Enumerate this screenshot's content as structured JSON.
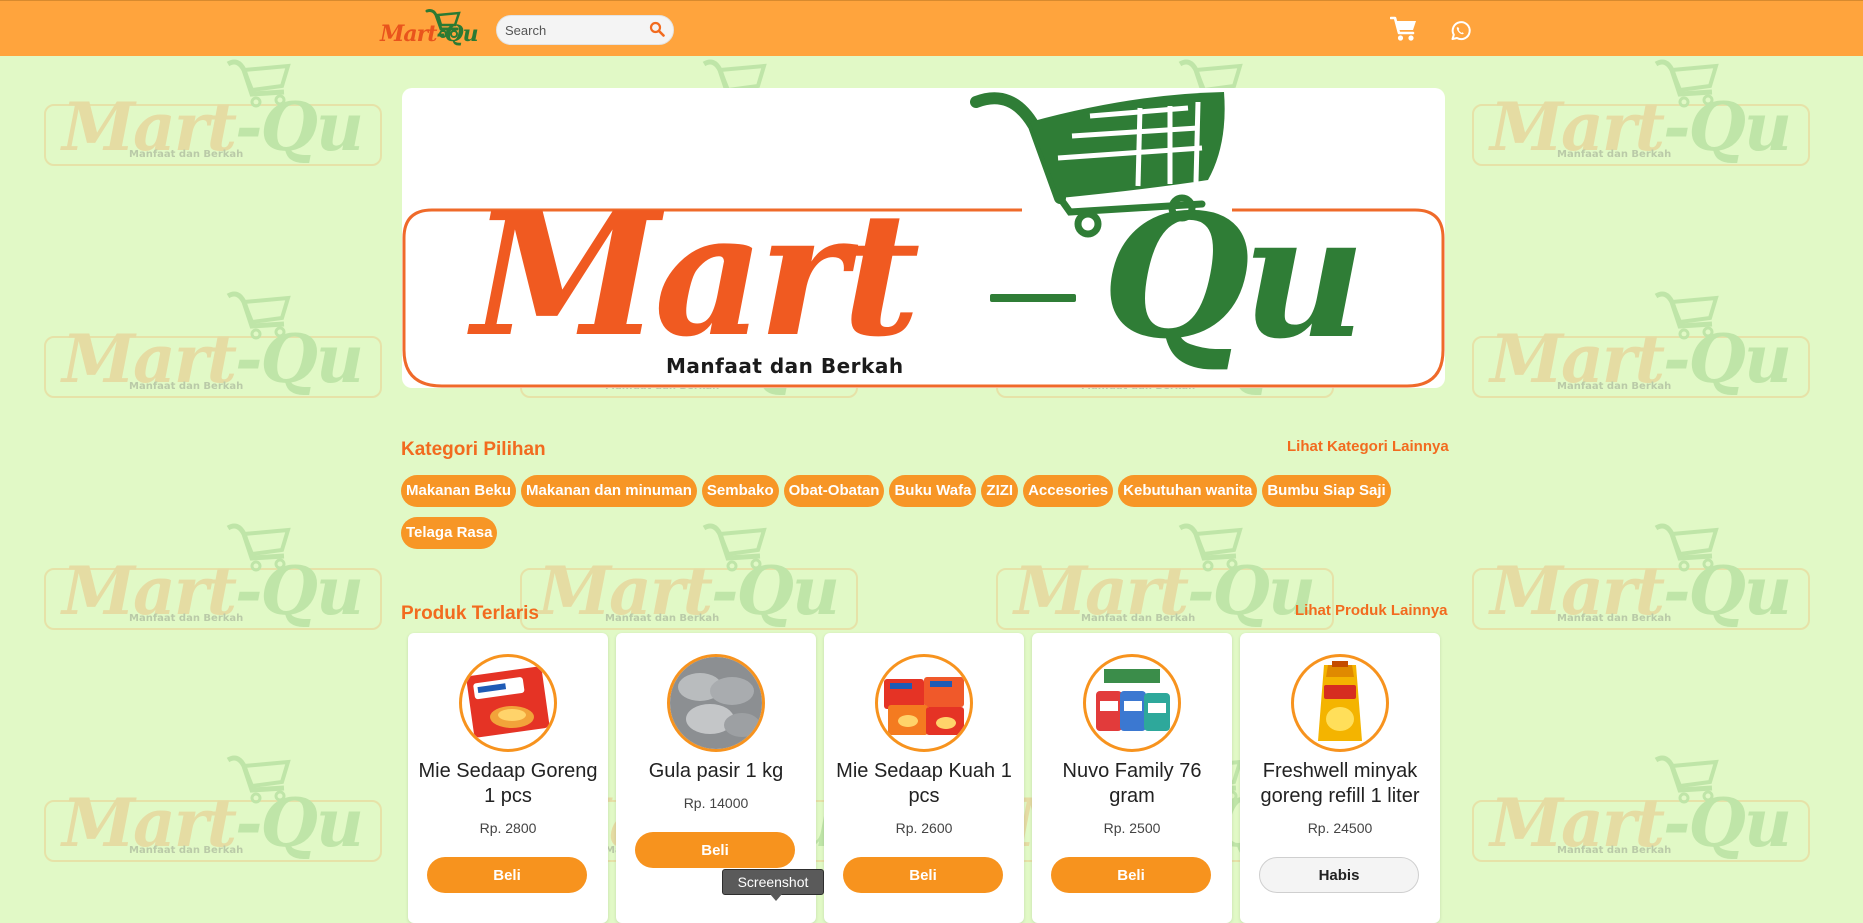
{
  "brand": {
    "logo_part1": "Mart",
    "logo_part2": "-Qu",
    "banner_part1": "Mart",
    "banner_part2": "Qu",
    "tagline": "Manfaat dan Berkah",
    "colors": {
      "orange": "#f05a21",
      "green": "#2f7d36",
      "navbar": "#ffa43d",
      "background": "#e1f9c6"
    }
  },
  "navbar": {
    "search_placeholder": "Search",
    "icons": [
      "search-icon",
      "cart-icon",
      "whatsapp-icon"
    ]
  },
  "categories": {
    "title": "Kategori Pilihan",
    "more_link": "Lihat Kategori Lainnya",
    "items": [
      "Makanan Beku",
      "Makanan dan minuman",
      "Sembako",
      "Obat-Obatan",
      "Buku Wafa",
      "ZIZI",
      "Accesories",
      "Kebutuhan wanita",
      "Bumbu Siap Saji",
      "Telaga Rasa"
    ]
  },
  "products": {
    "title": "Produk Terlaris",
    "more_link": "Lihat Produk Lainnya",
    "items": [
      {
        "name": "Mie Sedaap Goreng 1 pcs",
        "price": "Rp. 2800",
        "button": "Beli",
        "available": true
      },
      {
        "name": "Gula pasir 1 kg",
        "price": "Rp. 14000",
        "button": "Beli",
        "available": true
      },
      {
        "name": "Mie Sedaap Kuah 1 pcs",
        "price": "Rp. 2600",
        "button": "Beli",
        "available": true
      },
      {
        "name": "Nuvo Family 76 gram",
        "price": "Rp. 2500",
        "button": "Beli",
        "available": true
      },
      {
        "name": "Freshwell minyak goreng refill 1 liter",
        "price": "Rp. 24500",
        "button": "Habis",
        "available": false
      }
    ]
  },
  "tooltip": {
    "text": "Screenshot"
  }
}
